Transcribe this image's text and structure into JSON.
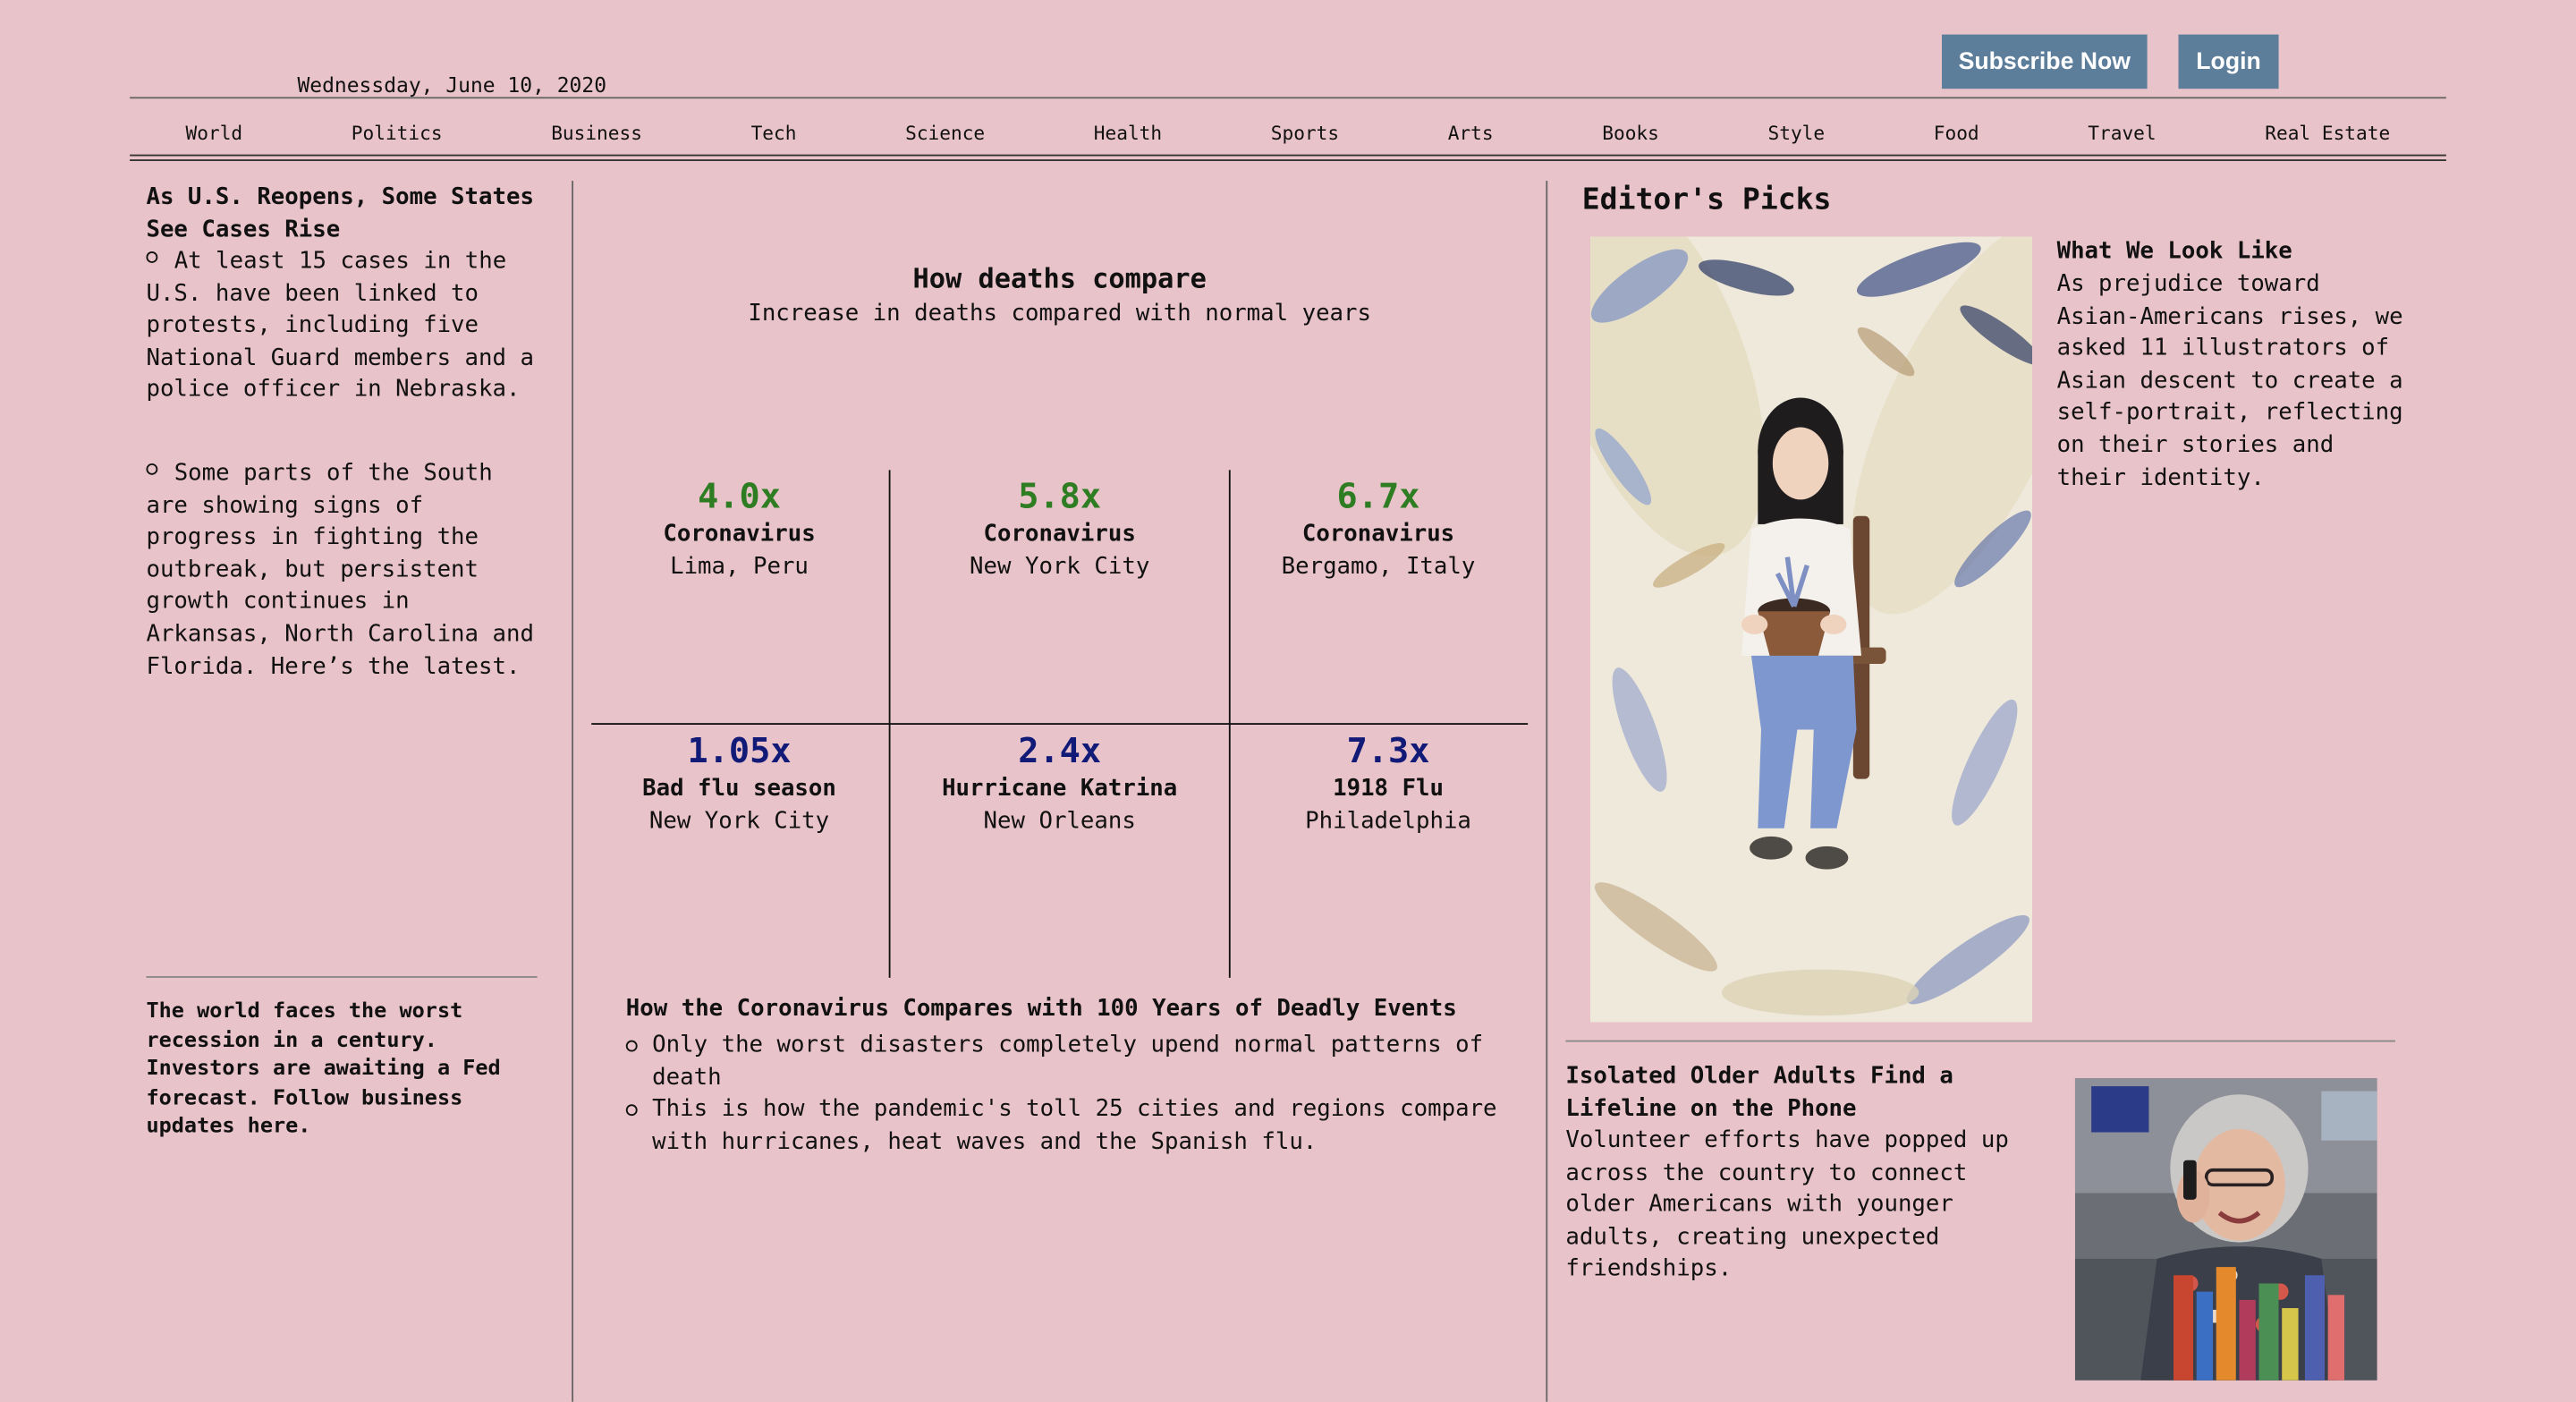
{
  "header": {
    "date": "Wednessday, June 10, 2020",
    "subscribe_label": "Subscribe Now",
    "login_label": "Login"
  },
  "nav": {
    "items": [
      "World",
      "Politics",
      "Business",
      "Tech",
      "Science",
      "Health",
      "Sports",
      "Arts",
      "Books",
      "Style",
      "Food",
      "Travel",
      "Real Estate"
    ]
  },
  "left": {
    "lead_title": "As U.S. Reopens, Some States See Cases Rise",
    "bullets": [
      "At least 15 cases in the U.S. have been linked to protests, including five National Guard members and a police officer in Nebraska.",
      "Some parts of the South are showing signs of progress in fighting the outbreak, but persistent growth continues in Arkansas, North Carolina and Florida. Here’s the latest."
    ],
    "recession_text": "The world faces the worst recession in a century. Investors are awaiting a Fed forecast. Follow business updates here."
  },
  "chart": {
    "title": "How deaths compare",
    "subtitle": "Increase in deaths compared with normal years",
    "colors": {
      "coronavirus": "#2e7d22",
      "historical": "#121a78"
    },
    "cells": [
      {
        "value": "4.0x",
        "label": "Coronavirus",
        "location": "Lima, Peru"
      },
      {
        "value": "5.8x",
        "label": "Coronavirus",
        "location": "New York City"
      },
      {
        "value": "6.7x",
        "label": "Coronavirus",
        "location": "Bergamo, Italy"
      },
      {
        "value": "1.05x",
        "label": "Bad flu season",
        "location": "New York City"
      },
      {
        "value": "2.4x",
        "label": "Hurricane Katrina",
        "location": "New Orleans"
      },
      {
        "value": "7.3x",
        "label": "1918 Flu",
        "location": "Philadelphia"
      }
    ],
    "summary_title": "How the Coronavirus Compares with 100 Years of Deadly Events",
    "summary_items": [
      "Only the worst disasters completely upend normal patterns of death",
      "This is how the pandemic's toll 25 cities and regions compare with hurricanes, heat waves and the Spanish flu."
    ]
  },
  "right": {
    "heading": "Editor's Picks",
    "pick1": {
      "title": "What We Look Like",
      "body": "As prejudice toward Asian-Americans rises, we asked 11 illustrators of Asian descent to create a self-portrait, reflecting on their stories and their identity."
    },
    "pick2": {
      "title": "Isolated Older Adults Find a Lifeline on the Phone",
      "body": "Volunteer efforts have popped up across the country to connect older Americans with younger adults, creating unexpected friendships."
    }
  }
}
